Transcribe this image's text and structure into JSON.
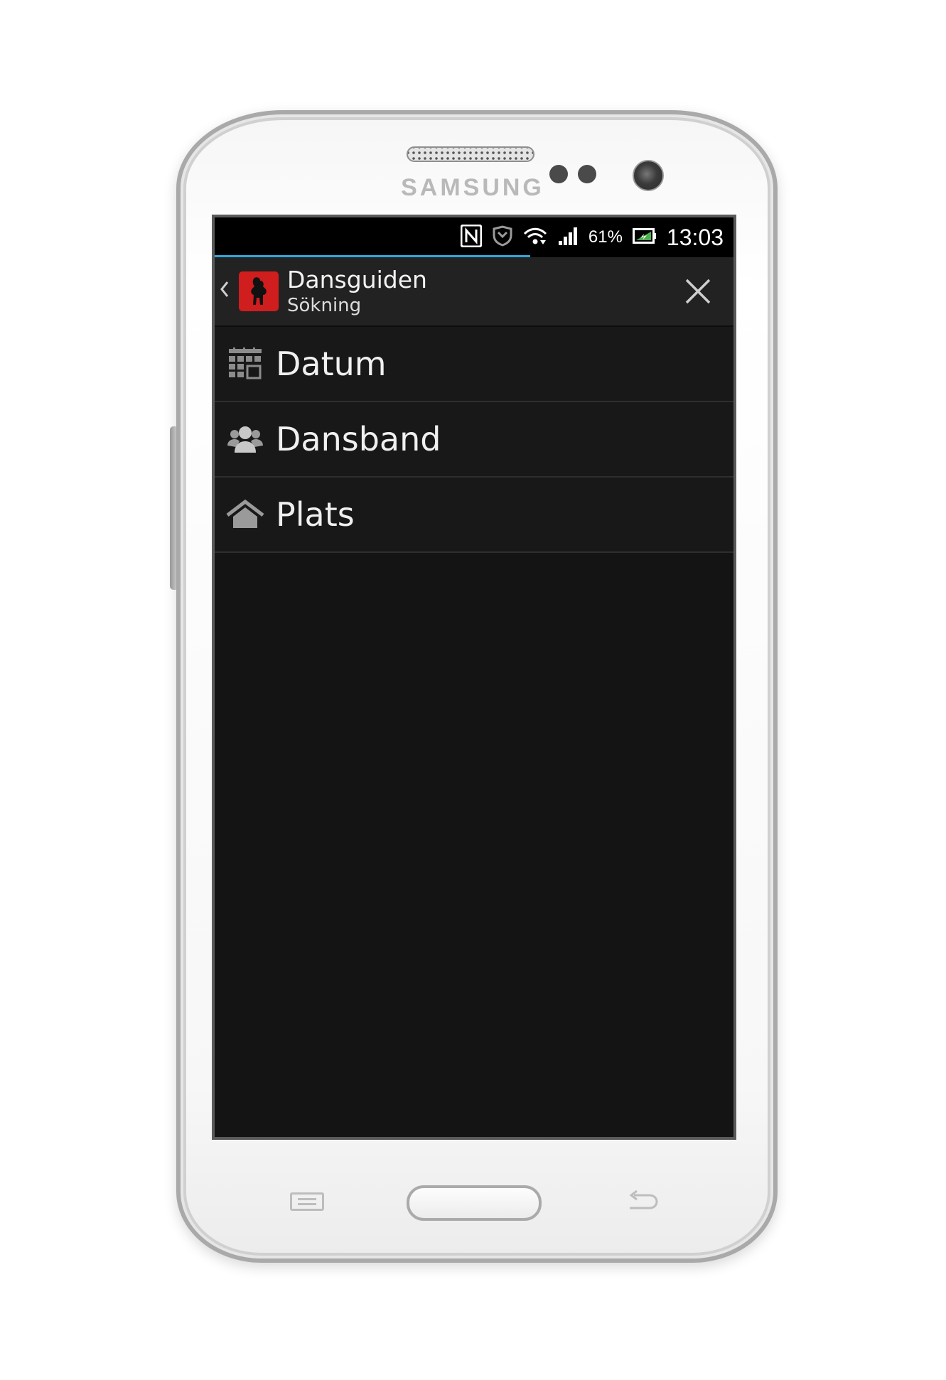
{
  "device": {
    "brand": "SAMSUNG"
  },
  "statusbar": {
    "icons": [
      "nfc-icon",
      "shield-icon",
      "wifi-icon",
      "signal-icon",
      "battery-icon"
    ],
    "battery_percent": "61%",
    "time": "13:03",
    "accent_color": "#33a5d7"
  },
  "actionbar": {
    "title": "Dansguiden",
    "subtitle": "Sökning",
    "icon_color": "#d01d1d"
  },
  "menu": {
    "items": [
      {
        "label": "Datum",
        "icon": "calendar-icon"
      },
      {
        "label": "Dansband",
        "icon": "group-icon"
      },
      {
        "label": "Plats",
        "icon": "home-icon"
      }
    ]
  }
}
